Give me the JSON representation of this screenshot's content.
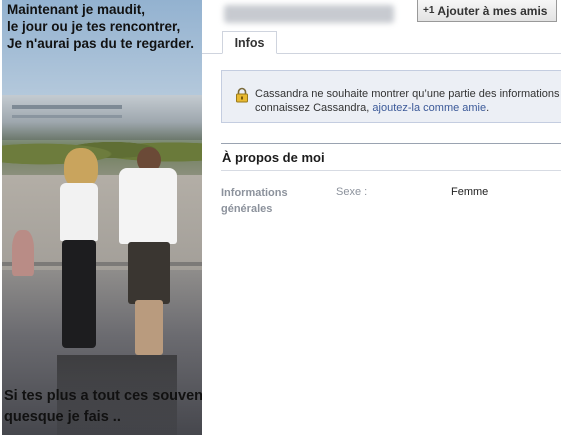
{
  "profile_picture": {
    "caption_top": [
      "Maintenant je maudit,",
      "le jour ou je tes rencontrer,",
      "Je n'aurai pas du te regarder."
    ],
    "caption_bottom": [
      "Si tes plus a tout ces souvenirs",
      "quesque je fais .."
    ]
  },
  "header": {
    "add_friend_icon": "+1",
    "add_friend_label": "Ajouter à mes amis"
  },
  "tabs": [
    {
      "label": "Infos"
    }
  ],
  "privacy_notice": {
    "icon": "lock-icon",
    "text_before": "Cassandra ne souhaite montrer qu’une partie des informations de",
    "text_line2": "connaissez Cassandra, ",
    "link_text": "ajoutez-la comme amie",
    "text_after": "."
  },
  "about": {
    "title": "À propos de moi",
    "section_label": "Informations générales",
    "field_label": "Sexe :",
    "field_value": "Femme"
  },
  "colors": {
    "link": "#3b5998",
    "notice_bg": "#eceff5",
    "label_gray": "#8c929c"
  }
}
